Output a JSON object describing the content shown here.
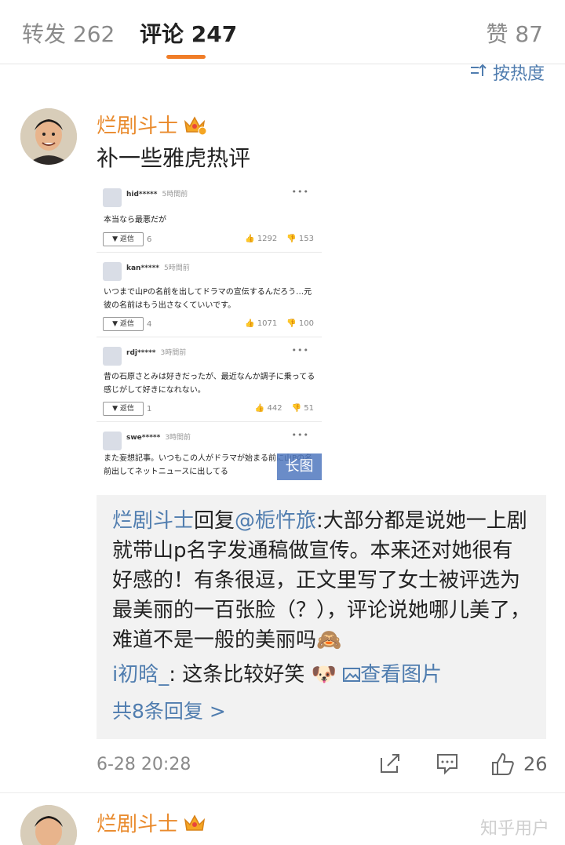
{
  "tabs": {
    "repost": "转发 262",
    "comments": "评论 247",
    "likes": "赞 87"
  },
  "sort": {
    "label": "按热度",
    "icon": "sort-icon"
  },
  "comment1": {
    "username": "烂剧斗士",
    "text": "补一些雅虎热评",
    "image": {
      "long_image_label": "长图",
      "items": [
        {
          "user": "hid*****",
          "time": "5時間前",
          "text": "本当なら最悪だが",
          "reply_label": "▼ 返信",
          "reply_count": "6",
          "up": "1292",
          "down": "153"
        },
        {
          "user": "kan*****",
          "time": "5時間前",
          "text": "いつまで山Pの名前を出してドラマの宣伝するんだろう…元彼の名前はもう出さなくていいです。",
          "reply_label": "▼ 返信",
          "reply_count": "4",
          "up": "1071",
          "down": "100"
        },
        {
          "user": "rdj*****",
          "time": "3時間前",
          "text": "昔の石原さとみは好きだったが、最近なんか調子に乗ってる感じがして好きになれない。",
          "reply_label": "▼ 返信",
          "reply_count": "1",
          "up": "442",
          "down": "51"
        },
        {
          "user": "swe*****",
          "time": "3時間前",
          "text": "また妄想記事。いつもこの人がドラマが始まる前に山Pの名前出してネットニュースに出してる"
        }
      ]
    },
    "replies": {
      "reply1_user": "烂剧斗士",
      "reply1_mid": "回复",
      "reply1_mention": "@栀忤旅",
      "reply1_text": ":大部分都是说她一上剧就带山p名字发通稿做宣传。本来还对她很有好感的！有条很逗，正文里写了女士被评选为最美丽的一百张脸（？），评论说她哪儿美了，难道不是一般的美丽吗🙈",
      "reply2_user": "i初晗_",
      "reply2_text": ": 这条比较好笑",
      "reply2_emoji": "🐶",
      "reply2_img_link": "查看图片",
      "total": "共8条回复 >"
    },
    "time": "6-28 20:28",
    "likes": "26"
  },
  "comment2": {
    "username": "烂剧斗士"
  },
  "watermark": "知乎用户",
  "colors": {
    "accent": "#f07d28",
    "link": "#507daf",
    "username": "#e98a2c"
  }
}
